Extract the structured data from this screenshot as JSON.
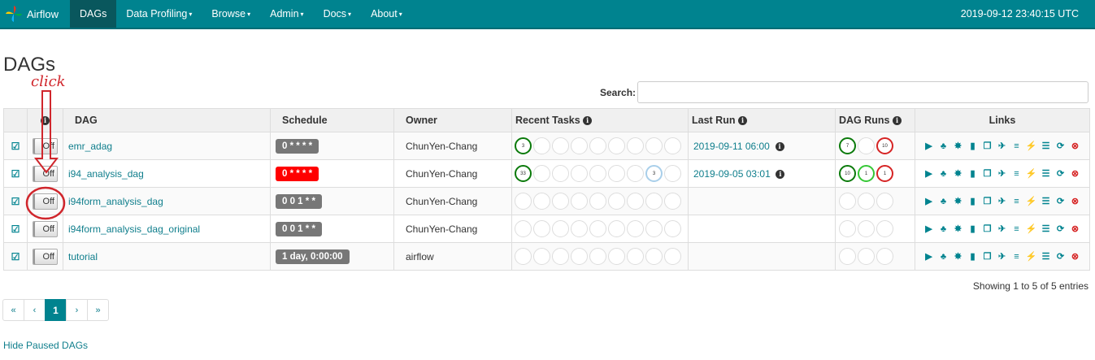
{
  "navbar": {
    "brand": "Airflow",
    "items": [
      {
        "label": "DAGs",
        "caret": ""
      },
      {
        "label": "Data Profiling",
        "caret": "▾"
      },
      {
        "label": "Browse",
        "caret": "▾"
      },
      {
        "label": "Admin",
        "caret": "▾"
      },
      {
        "label": "Docs",
        "caret": "▾"
      },
      {
        "label": "About",
        "caret": "▾"
      }
    ],
    "time": "2019-09-12 23:40:15 UTC"
  },
  "page_title": "DAGs",
  "annotation": "click",
  "search": {
    "label": "Search:",
    "value": ""
  },
  "table": {
    "headers": {
      "dag": "DAG",
      "schedule": "Schedule",
      "owner": "Owner",
      "recent_tasks": "Recent Tasks",
      "last_run": "Last Run",
      "dag_runs": "DAG Runs",
      "links": "Links"
    },
    "rows": [
      {
        "toggle": "Off",
        "dag": "emr_adag",
        "schedule": "0 * * * *",
        "schedule_color": "#777777",
        "owner": "ChunYen-Chang",
        "last_run": "2019-09-11 06:00",
        "tasks": [
          {
            "v": "3",
            "s": "green"
          },
          {
            "v": "",
            "s": ""
          },
          {
            "v": "",
            "s": ""
          },
          {
            "v": "",
            "s": ""
          },
          {
            "v": "",
            "s": ""
          },
          {
            "v": "",
            "s": ""
          },
          {
            "v": "",
            "s": ""
          },
          {
            "v": "",
            "s": ""
          },
          {
            "v": "",
            "s": ""
          }
        ],
        "runs": [
          {
            "v": "7",
            "s": "green"
          },
          {
            "v": "",
            "s": ""
          },
          {
            "v": "10",
            "s": "red"
          }
        ]
      },
      {
        "toggle": "Off",
        "dag": "i94_analysis_dag",
        "schedule": "0 * * * *",
        "schedule_color": "#ff0000",
        "owner": "ChunYen-Chang",
        "last_run": "2019-09-05 03:01",
        "tasks": [
          {
            "v": "33",
            "s": "green"
          },
          {
            "v": "",
            "s": ""
          },
          {
            "v": "",
            "s": ""
          },
          {
            "v": "",
            "s": ""
          },
          {
            "v": "",
            "s": ""
          },
          {
            "v": "",
            "s": ""
          },
          {
            "v": "",
            "s": ""
          },
          {
            "v": "3",
            "s": "blue"
          },
          {
            "v": "",
            "s": ""
          }
        ],
        "runs": [
          {
            "v": "10",
            "s": "green"
          },
          {
            "v": "1",
            "s": "lime"
          },
          {
            "v": "1",
            "s": "red"
          }
        ]
      },
      {
        "toggle": "Off",
        "dag": "i94form_analysis_dag",
        "schedule": "0 0 1 * *",
        "schedule_color": "#777777",
        "owner": "ChunYen-Chang",
        "last_run": "",
        "tasks": [
          {
            "v": "",
            "s": ""
          },
          {
            "v": "",
            "s": ""
          },
          {
            "v": "",
            "s": ""
          },
          {
            "v": "",
            "s": ""
          },
          {
            "v": "",
            "s": ""
          },
          {
            "v": "",
            "s": ""
          },
          {
            "v": "",
            "s": ""
          },
          {
            "v": "",
            "s": ""
          },
          {
            "v": "",
            "s": ""
          }
        ],
        "runs": [
          {
            "v": "",
            "s": ""
          },
          {
            "v": "",
            "s": ""
          },
          {
            "v": "",
            "s": ""
          }
        ]
      },
      {
        "toggle": "Off",
        "dag": "i94form_analysis_dag_original",
        "schedule": "0 0 1 * *",
        "schedule_color": "#777777",
        "owner": "ChunYen-Chang",
        "last_run": "",
        "tasks": [
          {
            "v": "",
            "s": ""
          },
          {
            "v": "",
            "s": ""
          },
          {
            "v": "",
            "s": ""
          },
          {
            "v": "",
            "s": ""
          },
          {
            "v": "",
            "s": ""
          },
          {
            "v": "",
            "s": ""
          },
          {
            "v": "",
            "s": ""
          },
          {
            "v": "",
            "s": ""
          },
          {
            "v": "",
            "s": ""
          }
        ],
        "runs": [
          {
            "v": "",
            "s": ""
          },
          {
            "v": "",
            "s": ""
          },
          {
            "v": "",
            "s": ""
          }
        ]
      },
      {
        "toggle": "Off",
        "dag": "tutorial",
        "schedule": "1 day, 0:00:00",
        "schedule_color": "#777777",
        "owner": "airflow",
        "last_run": "",
        "tasks": [
          {
            "v": "",
            "s": ""
          },
          {
            "v": "",
            "s": ""
          },
          {
            "v": "",
            "s": ""
          },
          {
            "v": "",
            "s": ""
          },
          {
            "v": "",
            "s": ""
          },
          {
            "v": "",
            "s": ""
          },
          {
            "v": "",
            "s": ""
          },
          {
            "v": "",
            "s": ""
          },
          {
            "v": "",
            "s": ""
          }
        ],
        "runs": [
          {
            "v": "",
            "s": ""
          },
          {
            "v": "",
            "s": ""
          },
          {
            "v": "",
            "s": ""
          }
        ]
      }
    ],
    "link_icons": [
      {
        "name": "trigger-dag-icon",
        "glyph": "▶"
      },
      {
        "name": "tree-view-icon",
        "glyph": "♣"
      },
      {
        "name": "graph-view-icon",
        "glyph": "✸"
      },
      {
        "name": "task-duration-icon",
        "glyph": "▮"
      },
      {
        "name": "task-tries-icon",
        "glyph": "❐"
      },
      {
        "name": "landing-times-icon",
        "glyph": "✈"
      },
      {
        "name": "gantt-icon",
        "glyph": "≡"
      },
      {
        "name": "code-view-icon",
        "glyph": "⚡"
      },
      {
        "name": "logs-icon",
        "glyph": "☰"
      },
      {
        "name": "refresh-icon",
        "glyph": "⟳"
      },
      {
        "name": "delete-dag-icon",
        "glyph": "⊗"
      }
    ]
  },
  "showing": "Showing 1 to 5 of 5 entries",
  "pager": [
    "«",
    "‹",
    "1",
    "›",
    "»"
  ],
  "hide_paused": "Hide Paused DAGs",
  "colors": {
    "navbar": "#00838f",
    "active_nav": "#09575d",
    "link": "#0f7e8c",
    "annotation": "#d0262c"
  }
}
